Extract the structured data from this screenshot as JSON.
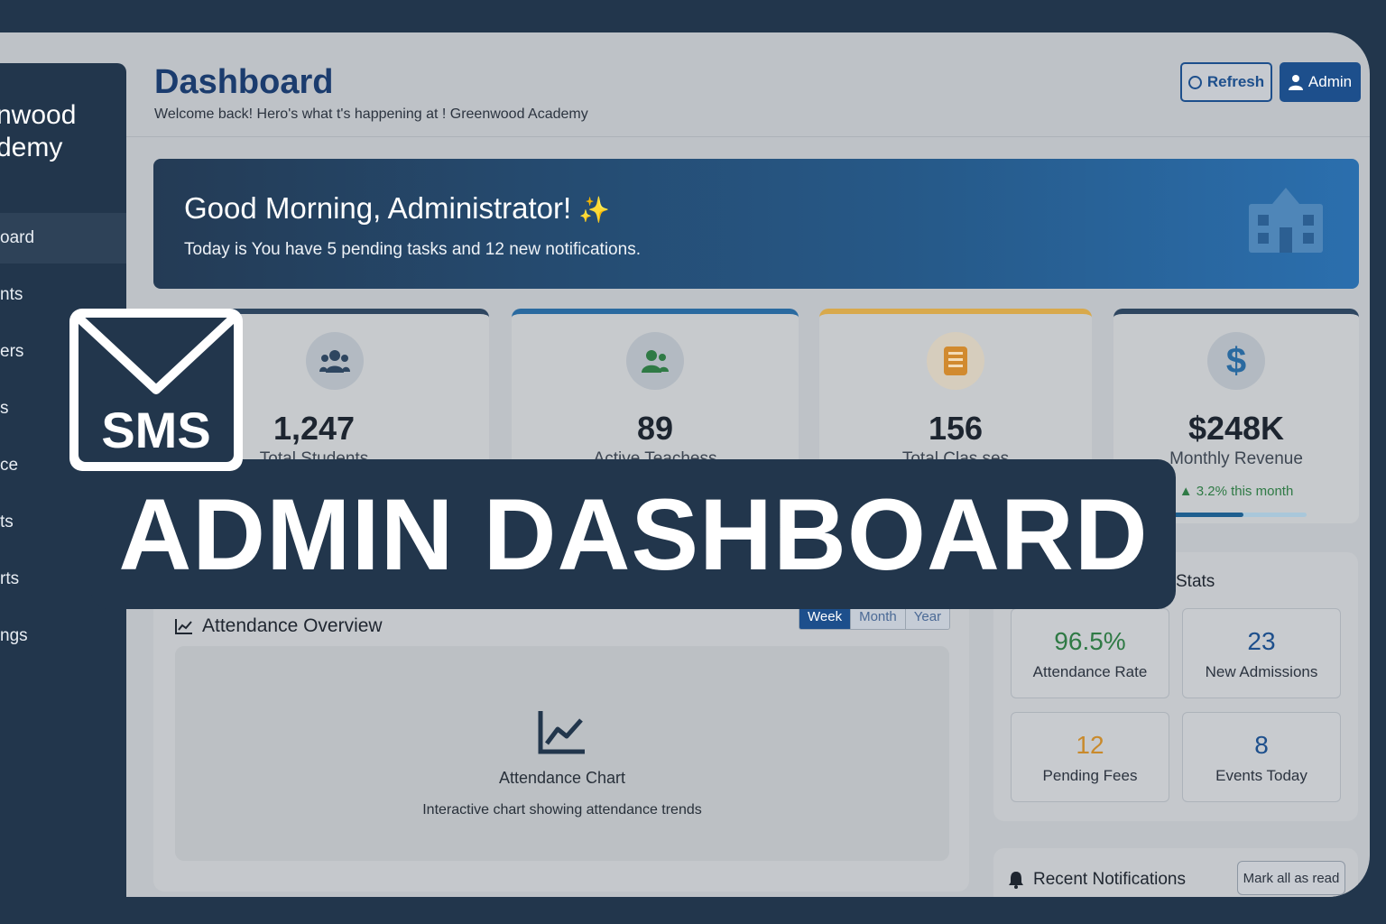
{
  "sidebar": {
    "brand_line1": "nwood",
    "brand_line2": "demy",
    "items": [
      {
        "label": "oard",
        "active": true
      },
      {
        "label": "nts"
      },
      {
        "label": "ers"
      },
      {
        "label": "s"
      },
      {
        "label": "ce"
      },
      {
        "label": "ts"
      },
      {
        "label": "rts"
      },
      {
        "label": "ngs"
      }
    ]
  },
  "header": {
    "title": "Dashboard",
    "subtitle": "Welcome back! Hero's what t's happening at ! Greenwood Academy",
    "refresh_label": "Refresh",
    "admin_label": "Admin"
  },
  "banner": {
    "greeting": "Good Morning, Administrator!",
    "subtitle": "Today is  You have 5 pending tasks and 12 new notifications.",
    "icon": "school-building-icon"
  },
  "stats": [
    {
      "value": "1,247",
      "label": "Total Students",
      "icon": "users-icon",
      "accent": "#2e4660"
    },
    {
      "value": "89",
      "label": "Active Teachess",
      "icon": "teacher-icon",
      "accent": "#2a6aa0"
    },
    {
      "value": "156",
      "label": "Total Clas ses",
      "icon": "book-icon",
      "accent": "#d8a94c"
    },
    {
      "value": "$248K",
      "label": "Monthly Revenue",
      "icon": "dollar-icon",
      "accent": "#2e4660",
      "trend": "3.2% this month",
      "progress": 0.55
    }
  ],
  "attendance": {
    "title": "Attendance Overview",
    "ranges": [
      "Week",
      "Month",
      "Year"
    ],
    "active_range": "Week",
    "chart_title": "Attendance Chart",
    "chart_subtitle": "Interactive chart showing attendance trends"
  },
  "quick_stats": {
    "title": "Stats",
    "tiles": [
      {
        "value": "96.5%",
        "label": "Attendance Rate",
        "color": "#2f7a45"
      },
      {
        "value": "23",
        "label": "New Admissions",
        "color": "#1d4f8c"
      },
      {
        "value": "12",
        "label": "Pending Fees",
        "color": "#c98a2c"
      },
      {
        "value": "8",
        "label": "Events Today",
        "color": "#1d4f8c"
      }
    ]
  },
  "notifications": {
    "title": "Recent Notifications",
    "mark_all_label": "Mark all as read"
  },
  "overlay": {
    "badge_text": "SMS",
    "headline": "ADMIN DASHBOARD"
  },
  "colors": {
    "primary": "#1d4f8c",
    "sidebar": "#22364c",
    "success": "#2f7a45",
    "warning": "#c98a2c"
  }
}
